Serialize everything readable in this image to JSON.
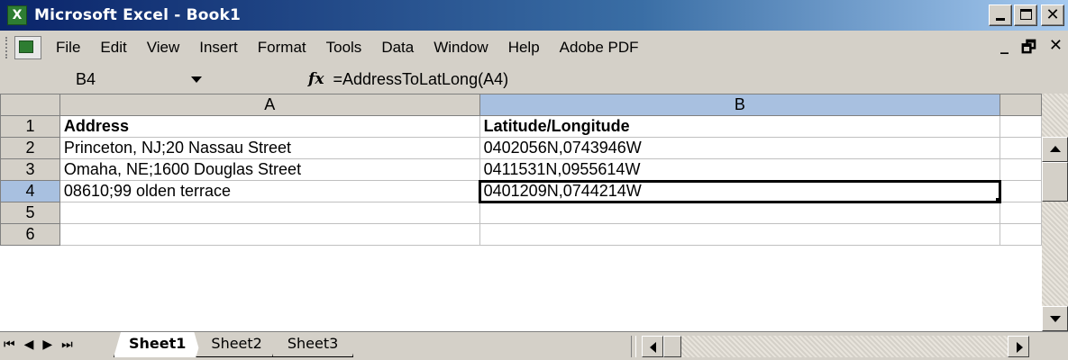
{
  "window": {
    "title": "Microsoft Excel - Book1",
    "app_icon": "excel-icon"
  },
  "menu": {
    "items": [
      "File",
      "Edit",
      "View",
      "Insert",
      "Format",
      "Tools",
      "Data",
      "Window",
      "Help",
      "Adobe PDF"
    ]
  },
  "formula_bar": {
    "name_box": "B4",
    "fx": "fx",
    "formula": "=AddressToLatLong(A4)"
  },
  "columns": [
    "A",
    "B"
  ],
  "rows": [
    {
      "num": "1",
      "a": "Address",
      "b": "Latitude/Longitude"
    },
    {
      "num": "2",
      "a": "Princeton, NJ;20 Nassau Street",
      "b": "0402056N,0743946W"
    },
    {
      "num": "3",
      "a": "Omaha, NE;1600 Douglas Street",
      "b": "0411531N,0955614W"
    },
    {
      "num": "4",
      "a": "08610;99 olden terrace",
      "b": "0401209N,0744214W"
    },
    {
      "num": "5",
      "a": "",
      "b": ""
    },
    {
      "num": "6",
      "a": "",
      "b": ""
    }
  ],
  "active_cell": "B4",
  "sheets": [
    {
      "label": "Sheet1",
      "active": true
    },
    {
      "label": "Sheet2",
      "active": false
    },
    {
      "label": "Sheet3",
      "active": false
    }
  ],
  "colors": {
    "title_gradient_start": "#0a246a",
    "title_gradient_end": "#a6caf0",
    "chrome": "#d4d0c8",
    "header_highlight": "#a8c0e0"
  }
}
